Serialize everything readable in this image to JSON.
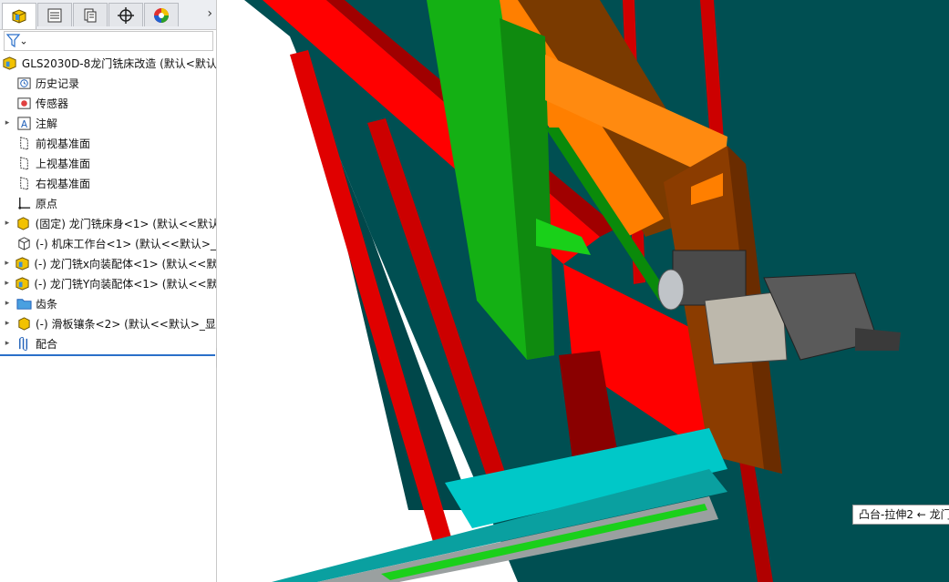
{
  "tabs": [
    {
      "name": "feature-manager",
      "active": true
    },
    {
      "name": "property-manager",
      "active": false
    },
    {
      "name": "configuration-manager",
      "active": false
    },
    {
      "name": "dimxpert-manager",
      "active": false
    },
    {
      "name": "display-manager",
      "active": false
    }
  ],
  "tabs_more_glyph": "›",
  "filter_icon": "filter-icon",
  "tree": [
    {
      "label": "GLS2030D-8龙门铣床改造  (默认<默认",
      "icon": "assembly",
      "expand": "",
      "level": 0
    },
    {
      "label": "历史记录",
      "icon": "history",
      "expand": "",
      "level": 1
    },
    {
      "label": "传感器",
      "icon": "sensor",
      "expand": "",
      "level": 1
    },
    {
      "label": "注解",
      "icon": "annotation",
      "expand": "▸",
      "level": 1
    },
    {
      "label": "前视基准面",
      "icon": "plane",
      "expand": "",
      "level": 1
    },
    {
      "label": "上视基准面",
      "icon": "plane",
      "expand": "",
      "level": 1
    },
    {
      "label": "右视基准面",
      "icon": "plane",
      "expand": "",
      "level": 1
    },
    {
      "label": "原点",
      "icon": "origin",
      "expand": "",
      "level": 1
    },
    {
      "label": "(固定) 龙门铣床身<1> (默认<<默认",
      "icon": "part-yellow",
      "expand": "▸",
      "level": 1
    },
    {
      "label": "(-) 机床工作台<1> (默认<<默认>_",
      "icon": "part-outline",
      "expand": "",
      "level": 1
    },
    {
      "label": "(-) 龙门铣x向装配体<1> (默认<<默认",
      "icon": "assembly",
      "expand": "▸",
      "level": 1
    },
    {
      "label": "(-) 龙门铣Y向装配体<1> (默认<<默认",
      "icon": "assembly",
      "expand": "▸",
      "level": 1
    },
    {
      "label": "齿条",
      "icon": "folder",
      "expand": "▸",
      "level": 1
    },
    {
      "label": "(-) 滑板镶条<2> (默认<<默认>_显",
      "icon": "part-yellow",
      "expand": "▸",
      "level": 1
    },
    {
      "label": "配合",
      "icon": "mates",
      "expand": "▸",
      "level": 1
    }
  ],
  "tooltip": "凸台-拉伸2 ← 龙门",
  "colors": {
    "teal": "#004f52",
    "red": "#ff0000",
    "darkred": "#8a0000",
    "orange": "#ff7f00",
    "brown": "#8b3c00",
    "green": "#19b219",
    "cyan": "#00c8c8",
    "gray": "#9a9a9a"
  }
}
